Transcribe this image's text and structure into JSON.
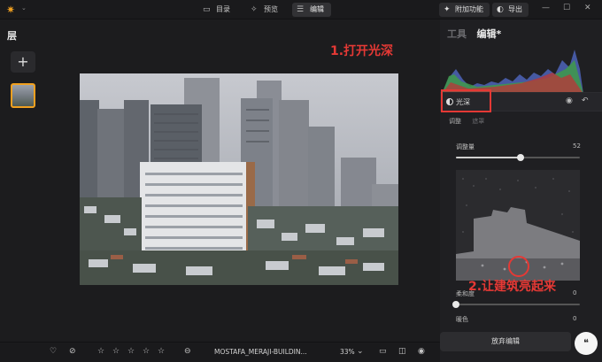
{
  "topbar": {
    "tabs": [
      {
        "label": "目录",
        "icon": "folder-icon"
      },
      {
        "label": "预览",
        "icon": "sparkle-icon"
      },
      {
        "label": "编辑",
        "icon": "sliders-icon"
      }
    ],
    "addon_label": "附加功能",
    "export_label": "导出"
  },
  "left": {
    "layers_title": "层"
  },
  "panel": {
    "tabs": [
      {
        "label": "工具"
      },
      {
        "label": "编辑*"
      }
    ],
    "tool_name": "光深",
    "subtabs": [
      "调整",
      "遮罩"
    ],
    "sliders": [
      {
        "label": "调整量",
        "value": "52",
        "fraction": 0.52
      },
      {
        "label": "柔和度",
        "value": "0",
        "fraction": 0
      },
      {
        "label": "暖色",
        "value": "0",
        "fraction": 0
      }
    ],
    "discard_label": "放弃编辑"
  },
  "bottombar": {
    "filename": "MOSTAFA_MERAJI-BUILDIN...",
    "zoom": "33%",
    "stars": 0
  },
  "annotations": {
    "step1": "1.打开光深",
    "step2": "2.让建筑亮起来"
  },
  "colors": {
    "accent": "#f0a020",
    "annotation": "#e53935"
  }
}
